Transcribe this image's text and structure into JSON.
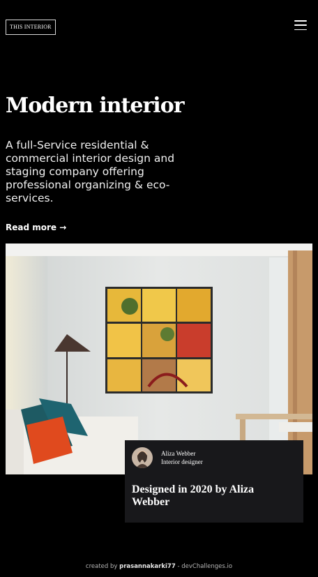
{
  "header": {
    "logo": "THIS INTERIOR"
  },
  "hero": {
    "title": "Modern interior",
    "description": "A full-Service residential & commercial interior design and staging company offering professional organizing & eco-services.",
    "read_more": "Read more →"
  },
  "designer_card": {
    "name": "Aliza Webber",
    "role": "Interior designer",
    "title": "Designed in 2020 by Aliza Webber"
  },
  "footer": {
    "prefix": "created by",
    "author": "prasannakarki77",
    "suffix": "- devChallenges.io"
  },
  "icons": {
    "menu": "hamburger-menu-icon"
  }
}
